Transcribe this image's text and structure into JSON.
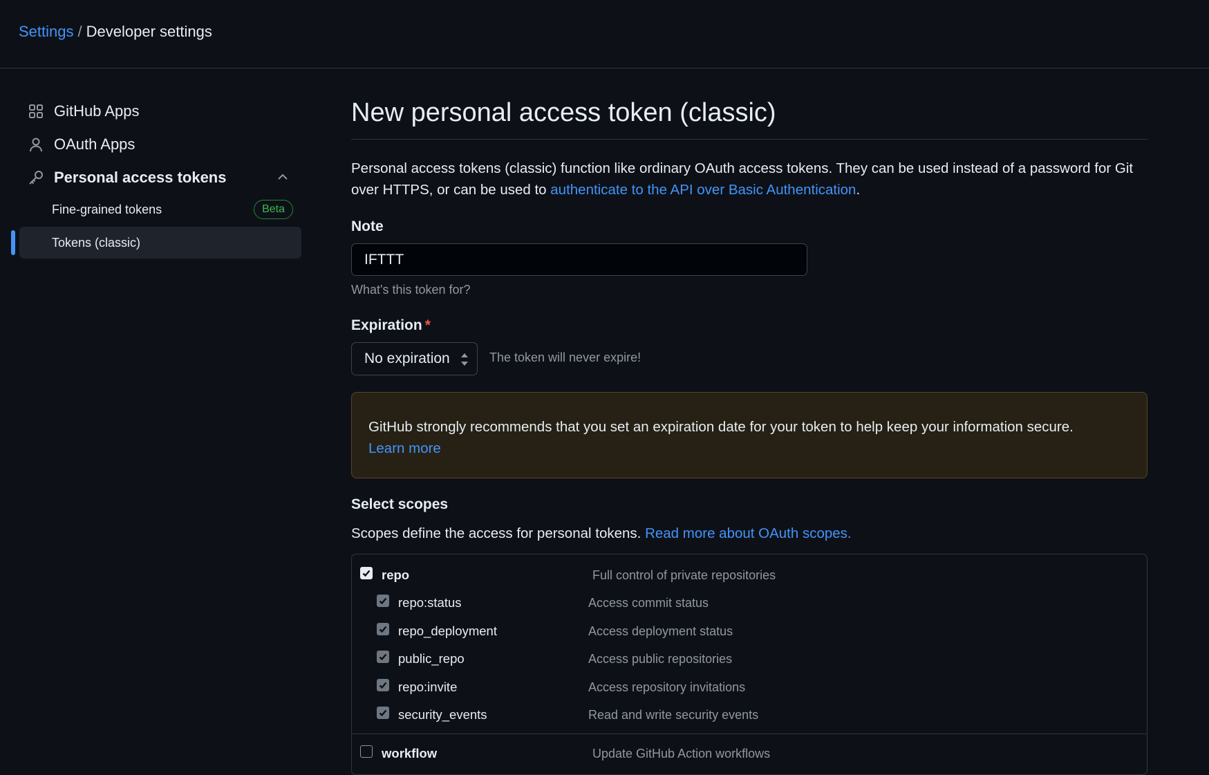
{
  "breadcrumb": {
    "settings": "Settings",
    "separator": "/",
    "current": "Developer settings"
  },
  "sidebar": {
    "items": [
      {
        "label": "GitHub Apps",
        "icon": "apps-grid-icon"
      },
      {
        "label": "OAuth Apps",
        "icon": "person-icon"
      },
      {
        "label": "Personal access tokens",
        "icon": "key-icon",
        "expanded": true
      }
    ],
    "sub_items": [
      {
        "label": "Fine-grained tokens",
        "badge": "Beta"
      },
      {
        "label": "Tokens (classic)",
        "selected": true
      }
    ]
  },
  "page": {
    "title": "New personal access token (classic)",
    "intro_text": "Personal access tokens (classic) function like ordinary OAuth access tokens. They can be used instead of a password for Git over HTTPS, or can be used to ",
    "intro_link": "authenticate to the API over Basic Authentication",
    "intro_end": "."
  },
  "note": {
    "label": "Note",
    "value": "IFTTT",
    "hint": "What's this token for?"
  },
  "expiration": {
    "label": "Expiration",
    "required_mark": "*",
    "selected": "No expiration",
    "note": "The token will never expire!"
  },
  "warning": {
    "text": "GitHub strongly recommends that you set an expiration date for your token to help keep your information secure.",
    "link": "Learn more"
  },
  "scopes": {
    "title": "Select scopes",
    "description": "Scopes define the access for personal tokens. ",
    "link": "Read more about OAuth scopes.",
    "items": [
      {
        "name": "repo",
        "desc": "Full control of private repositories",
        "checked": true,
        "parent": true
      },
      {
        "name": "repo:status",
        "desc": "Access commit status",
        "checked": true,
        "parent": false
      },
      {
        "name": "repo_deployment",
        "desc": "Access deployment status",
        "checked": true,
        "parent": false
      },
      {
        "name": "public_repo",
        "desc": "Access public repositories",
        "checked": true,
        "parent": false
      },
      {
        "name": "repo:invite",
        "desc": "Access repository invitations",
        "checked": true,
        "parent": false
      },
      {
        "name": "security_events",
        "desc": "Read and write security events",
        "checked": true,
        "parent": false
      },
      {
        "name": "workflow",
        "desc": "Update GitHub Action workflows",
        "checked": false,
        "parent": true
      }
    ]
  },
  "colors": {
    "background": "#0d1117",
    "link": "#4493f8",
    "border": "#30363d",
    "warning_bg": "#272115",
    "badge_green": "#3fb950"
  }
}
